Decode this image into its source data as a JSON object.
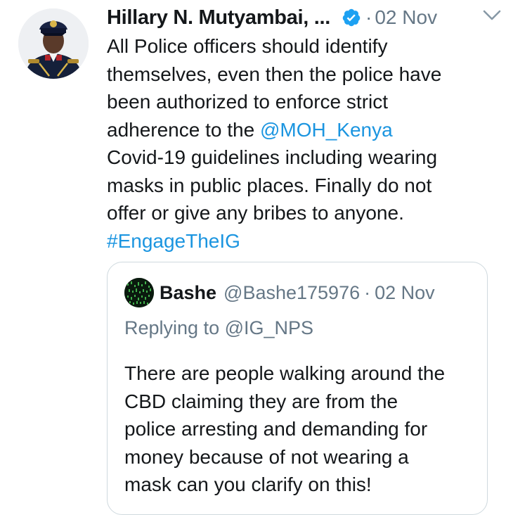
{
  "tweet": {
    "author": {
      "name": "Hillary N. Mutyambai, ...",
      "verified": true,
      "avatar_icon": "police-officer-avatar"
    },
    "separator": "·",
    "timestamp": "02 Nov",
    "menu_icon": "chevron-down-icon",
    "body": {
      "line1": "All Police officers should identify",
      "line2": "themselves, even then the police have",
      "line3": "been authorized to enforce strict",
      "line4_prefix": "adherence to the ",
      "mention": "@MOH_Kenya",
      "line5": "Covid-19 guidelines including wearing",
      "line6": "masks in public places. Finally do not",
      "line7": "offer or give any bribes to anyone.",
      "hashtag": "#EngageTheIG"
    }
  },
  "quoted_tweet": {
    "name": "Bashe",
    "handle": "@Bashe175976",
    "separator": "·",
    "timestamp": "02 Nov",
    "replying_to": "Replying to @IG_NPS",
    "body": {
      "line1": "There are people walking around the",
      "line2": "CBD claiming they are from the",
      "line3": "police arresting and demanding for",
      "line4": "money because of not wearing a",
      "line5": "mask can you clarify on this!"
    }
  },
  "colors": {
    "text": "#14171a",
    "secondary": "#657786",
    "link": "#1b95e0",
    "verified": "#1da1f2",
    "border": "#cfd9de"
  }
}
